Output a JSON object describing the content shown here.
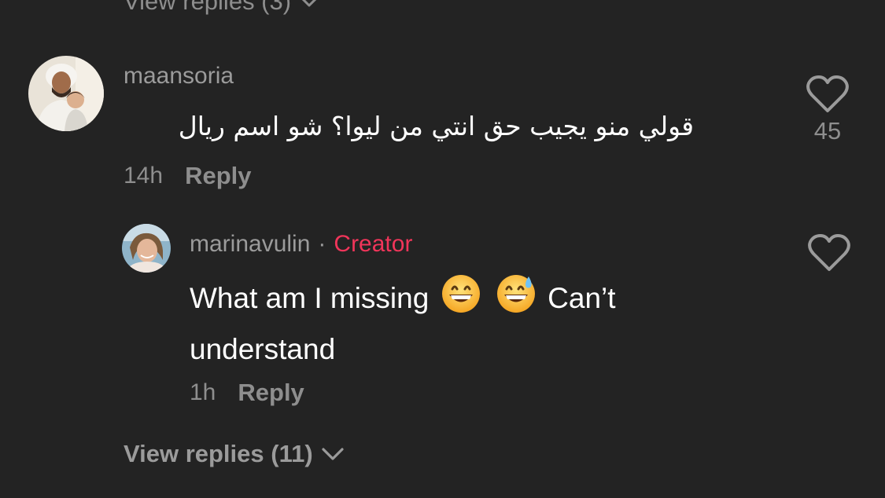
{
  "top_view_replies": {
    "label": "View replies (3)"
  },
  "comments": [
    {
      "username": "maansoria",
      "text": "قولي منو يجيب حق انتي من ليوا؟ شو اسم ريال",
      "timestamp": "14h",
      "reply_label": "Reply",
      "like_count": "45",
      "avatar_icon": "user-photo-avatar"
    },
    {
      "username": "marinavulin",
      "separator": "·",
      "badge": "Creator",
      "text_before": "What am I missing",
      "text_after": "Can’t",
      "text_line2": "understand",
      "timestamp": "1h",
      "reply_label": "Reply",
      "avatar_icon": "user-photo-avatar"
    }
  ],
  "view_replies": {
    "label": "View replies (11)"
  },
  "colors": {
    "background": "#232323",
    "creator_badge": "#f1355a",
    "muted_text": "#8e8e8e",
    "primary_text": "#ffffff"
  },
  "icons": [
    "heart-outline-icon",
    "chevron-down-icon",
    "grinning-emoji-icon",
    "sweat-smile-emoji-icon"
  ]
}
